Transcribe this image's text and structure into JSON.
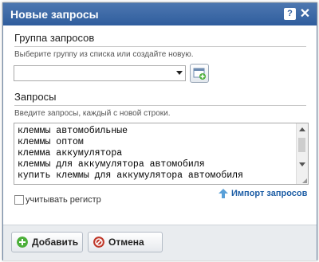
{
  "dialog": {
    "title": "Новые запросы",
    "help_icon": "help-icon",
    "close_icon": "close-icon"
  },
  "group_section": {
    "title": "Группа запросов",
    "hint": "Выберите группу из списка или создайте новую.",
    "select_value": "",
    "new_group_icon": "new-group-icon"
  },
  "queries_section": {
    "title": "Запросы",
    "hint": "Введите запросы, каждый с новой строки.",
    "lines": [
      "клеммы автомобильные",
      "клеммы оптом",
      "клемма аккумулятора",
      "клеммы для аккумулятора автомобиля",
      "купить клеммы для аккумулятора автомобиля"
    ],
    "import_label": "Импорт запросов"
  },
  "case_checkbox": {
    "label": "учитывать регистр",
    "checked": false
  },
  "footer": {
    "add_label": "Добавить",
    "cancel_label": "Отмена"
  },
  "colors": {
    "titlebar": "#2f5d9d",
    "link": "#1f5fa6",
    "add_icon": "#4caf3a",
    "cancel_icon": "#c0392b"
  }
}
